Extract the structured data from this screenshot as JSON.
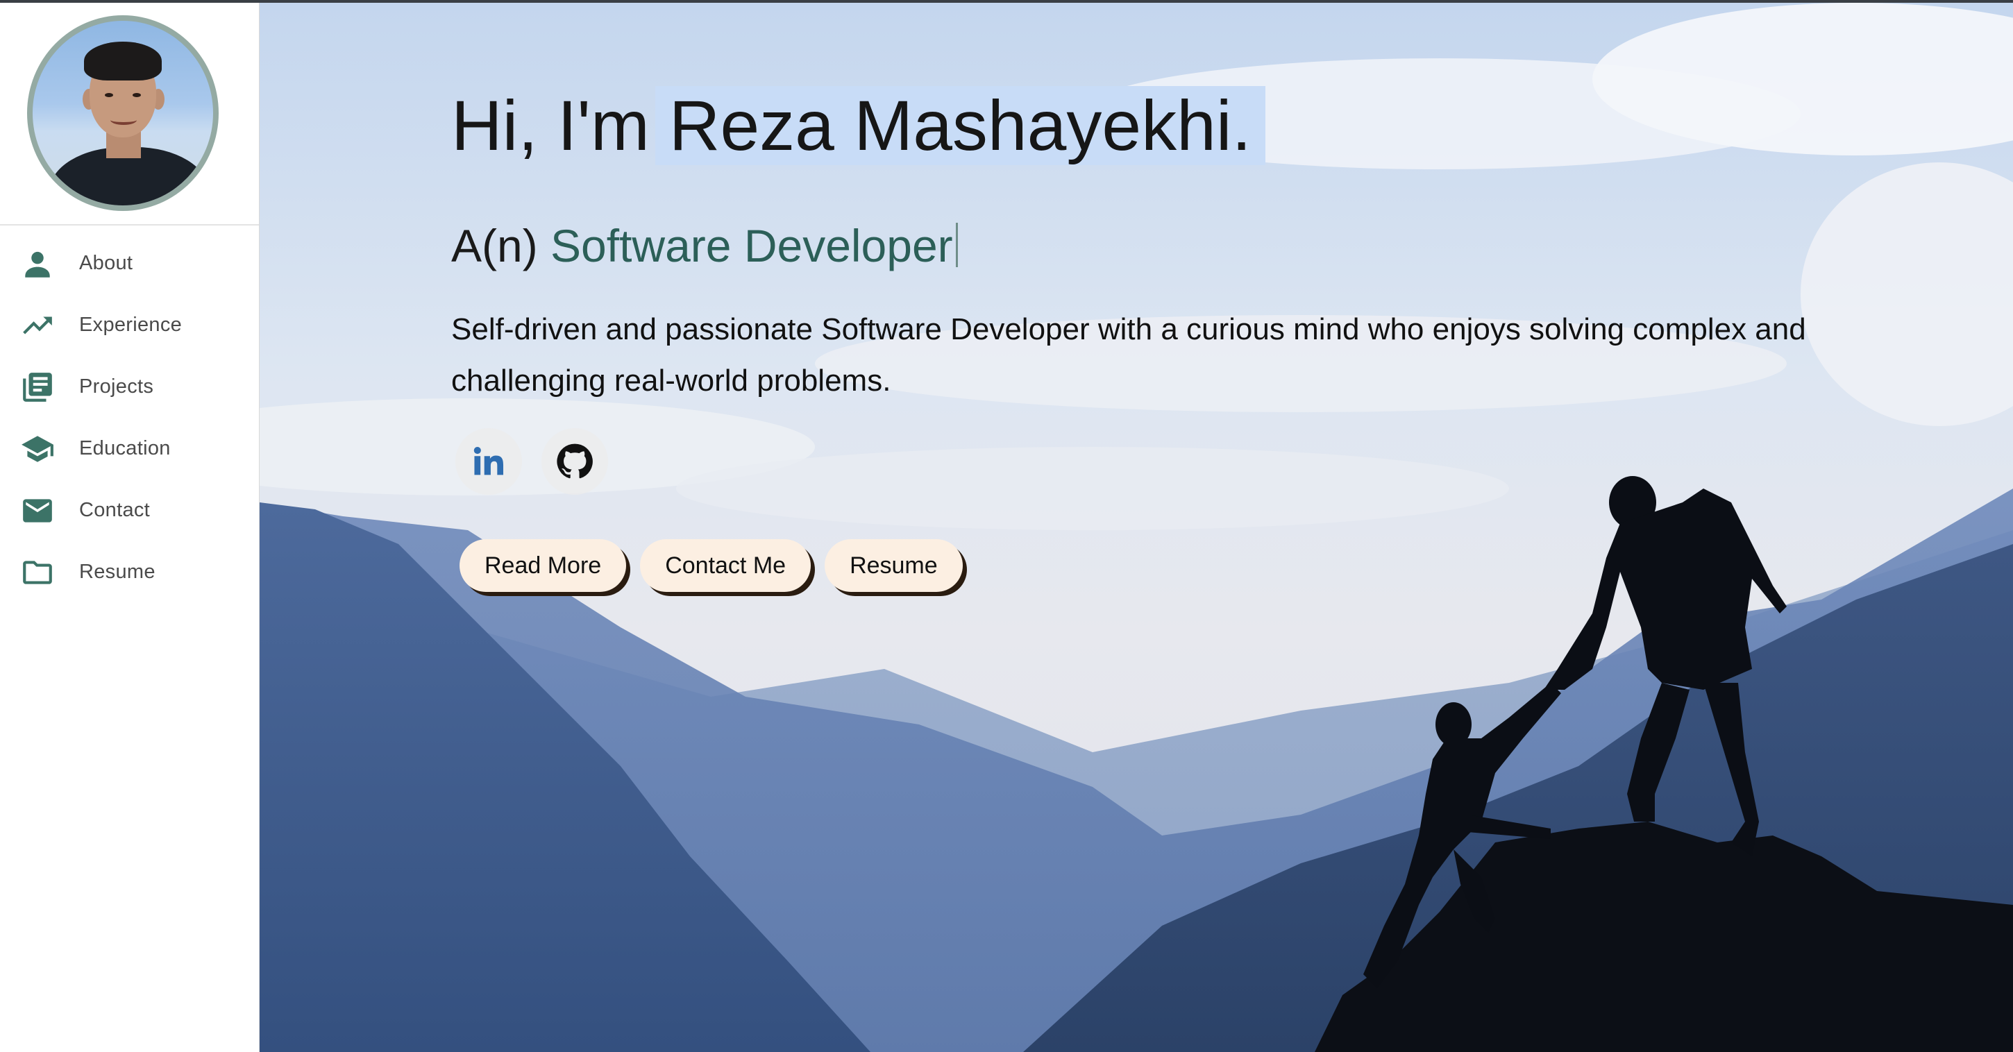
{
  "sidebar": {
    "items": [
      {
        "label": "About",
        "icon": "person-icon"
      },
      {
        "label": "Experience",
        "icon": "trending-up-icon"
      },
      {
        "label": "Projects",
        "icon": "library-books-icon"
      },
      {
        "label": "Education",
        "icon": "graduation-cap-icon"
      },
      {
        "label": "Contact",
        "icon": "mail-icon"
      },
      {
        "label": "Resume",
        "icon": "folder-icon"
      }
    ]
  },
  "hero": {
    "greeting_prefix": "Hi, I'm",
    "name": "Reza Mashayekhi.",
    "role_prefix": "A(n)",
    "role": "Software Developer",
    "bio": "Self-driven and passionate Software Developer with a curious mind who enjoys solving complex and challenging real-world problems.",
    "social": [
      {
        "icon": "linkedin-icon"
      },
      {
        "icon": "github-icon"
      }
    ],
    "buttons": {
      "read_more": "Read More",
      "contact_me": "Contact Me",
      "resume": "Resume"
    }
  },
  "colors": {
    "accent": "#3c7367",
    "role_text": "#2c5f58",
    "name_highlight": "#c8dcf7",
    "button_bg": "#fcefe2",
    "linkedin": "#2e6db1"
  }
}
